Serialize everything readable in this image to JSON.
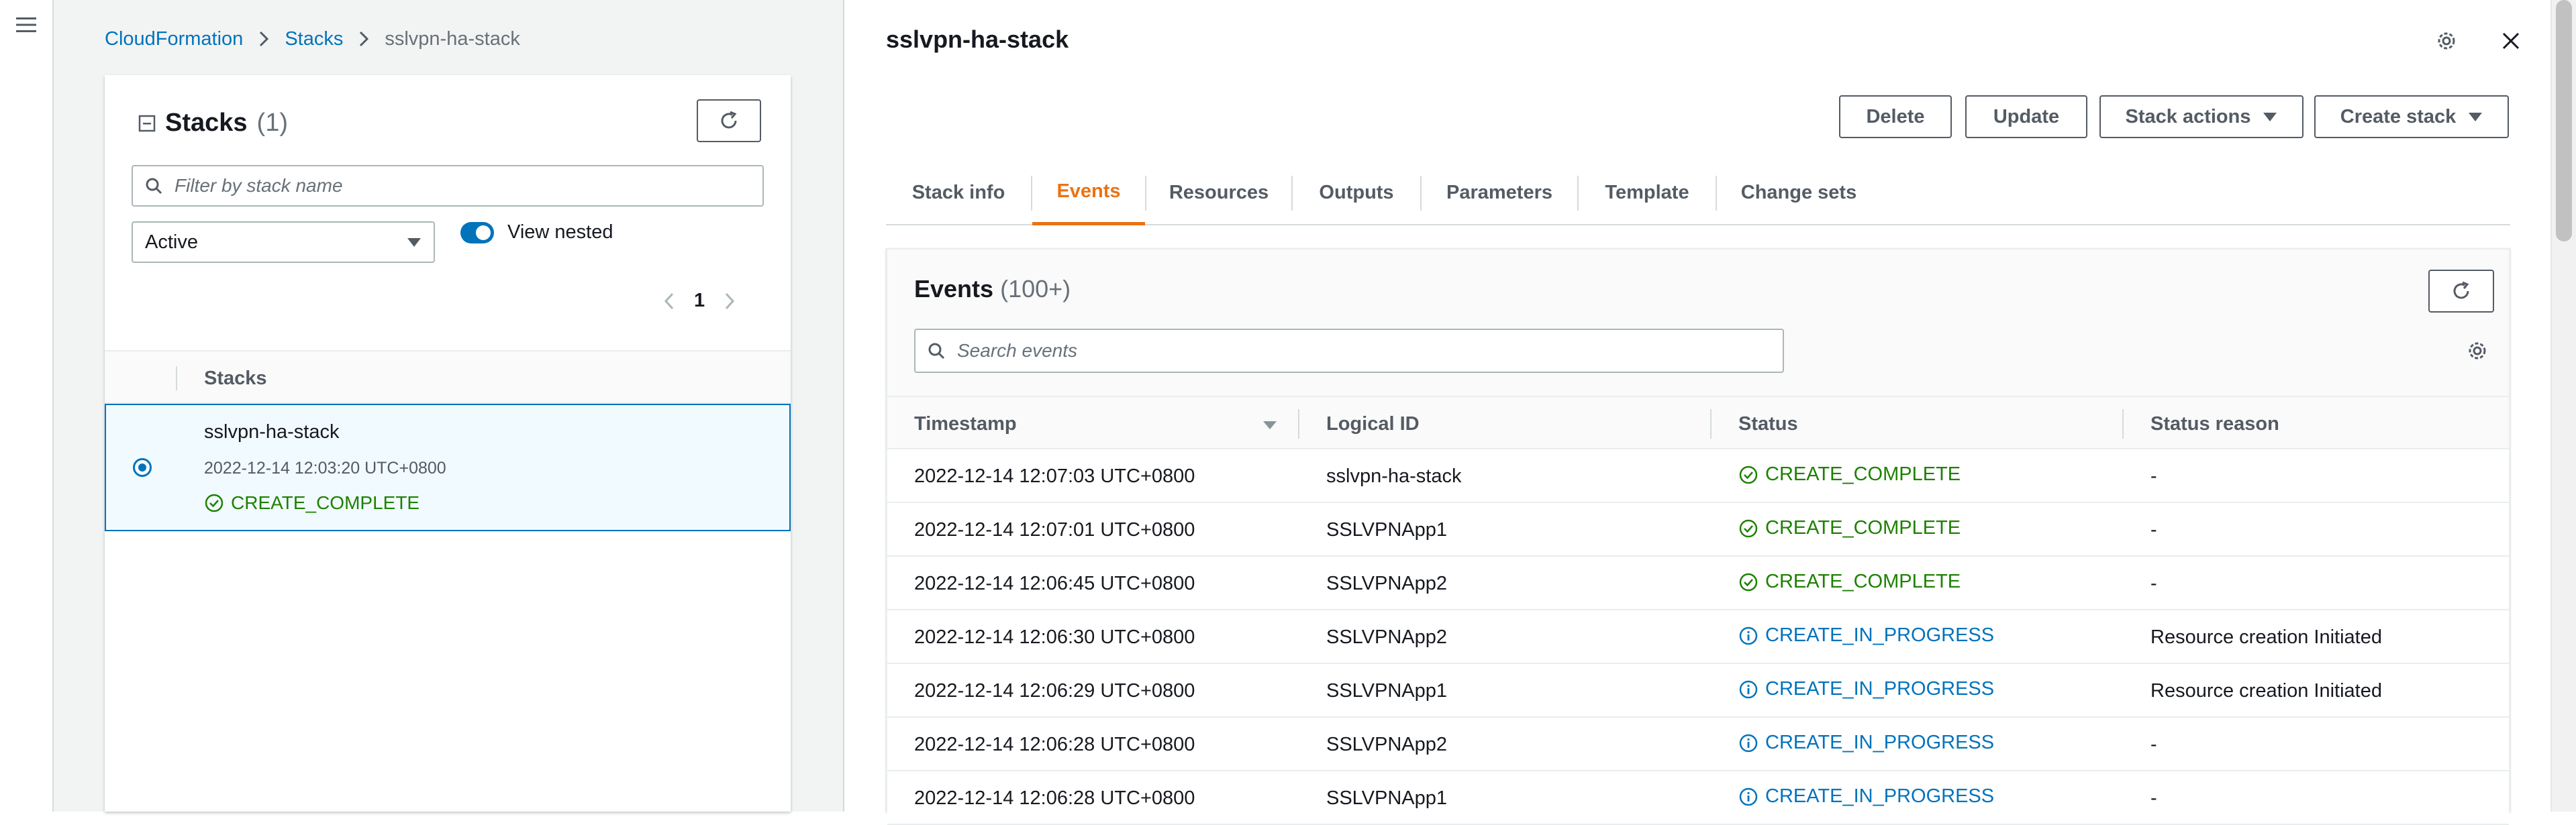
{
  "breadcrumb": {
    "items": [
      "CloudFormation",
      "Stacks"
    ],
    "current": "sslvpn-ha-stack"
  },
  "stacks_panel": {
    "title": "Stacks",
    "count": "(1)",
    "filter_placeholder": "Filter by stack name",
    "status_filter": "Active",
    "view_nested_label": "View nested",
    "view_nested_on": true,
    "page": "1",
    "column_header": "Stacks",
    "rows": [
      {
        "name": "sslvpn-ha-stack",
        "time": "2022-12-14 12:03:20 UTC+0800",
        "status": "CREATE_COMPLETE",
        "selected": true
      }
    ]
  },
  "detail": {
    "title": "sslvpn-ha-stack",
    "actions": {
      "delete": "Delete",
      "update": "Update",
      "stack_actions": "Stack actions",
      "create_stack": "Create stack"
    },
    "tabs": [
      "Stack info",
      "Events",
      "Resources",
      "Outputs",
      "Parameters",
      "Template",
      "Change sets"
    ],
    "active_tab": "Events"
  },
  "events": {
    "title": "Events",
    "count": "(100+)",
    "search_placeholder": "Search events",
    "columns": {
      "timestamp": "Timestamp",
      "logical_id": "Logical ID",
      "status": "Status",
      "reason": "Status reason"
    },
    "rows": [
      {
        "timestamp": "2022-12-14 12:07:03 UTC+0800",
        "logical_id": "sslvpn-ha-stack",
        "status": "CREATE_COMPLETE",
        "type": "ok",
        "reason": "-"
      },
      {
        "timestamp": "2022-12-14 12:07:01 UTC+0800",
        "logical_id": "SSLVPNApp1",
        "status": "CREATE_COMPLETE",
        "type": "ok",
        "reason": "-"
      },
      {
        "timestamp": "2022-12-14 12:06:45 UTC+0800",
        "logical_id": "SSLVPNApp2",
        "status": "CREATE_COMPLETE",
        "type": "ok",
        "reason": "-"
      },
      {
        "timestamp": "2022-12-14 12:06:30 UTC+0800",
        "logical_id": "SSLVPNApp2",
        "status": "CREATE_IN_PROGRESS",
        "type": "info",
        "reason": "Resource creation Initiated"
      },
      {
        "timestamp": "2022-12-14 12:06:29 UTC+0800",
        "logical_id": "SSLVPNApp1",
        "status": "CREATE_IN_PROGRESS",
        "type": "info",
        "reason": "Resource creation Initiated"
      },
      {
        "timestamp": "2022-12-14 12:06:28 UTC+0800",
        "logical_id": "SSLVPNApp2",
        "status": "CREATE_IN_PROGRESS",
        "type": "info",
        "reason": "-"
      },
      {
        "timestamp": "2022-12-14 12:06:28 UTC+0800",
        "logical_id": "SSLVPNApp1",
        "status": "CREATE_IN_PROGRESS",
        "type": "info",
        "reason": "-"
      }
    ]
  },
  "colors": {
    "link": "#0073bb",
    "success": "#1d8102",
    "info": "#0073bb",
    "active_tab": "#ec7211"
  },
  "icons": [
    "menu-icon",
    "chevron-right-icon",
    "collapse-icon",
    "refresh-icon",
    "search-icon",
    "caret-down-icon",
    "chevron-left-icon",
    "success-icon",
    "info-icon",
    "drag-handle-icon",
    "settings-icon",
    "close-icon",
    "sort-caret-icon"
  ]
}
